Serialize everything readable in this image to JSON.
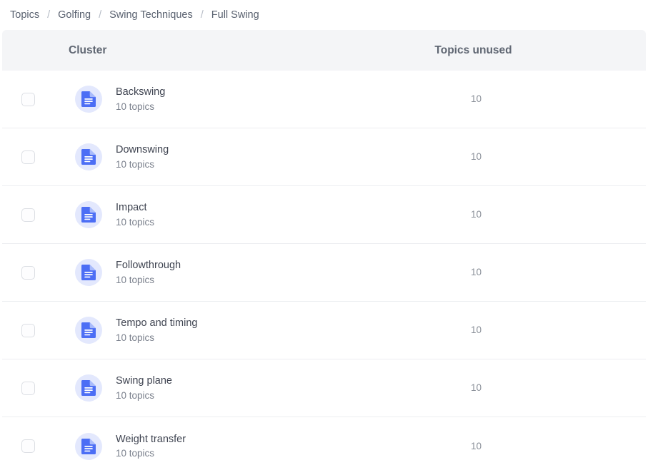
{
  "breadcrumb": {
    "separator": "/",
    "items": [
      {
        "label": "Topics"
      },
      {
        "label": "Golfing"
      },
      {
        "label": "Swing Techniques"
      },
      {
        "label": "Full Swing"
      }
    ]
  },
  "table": {
    "columns": {
      "cluster": "Cluster",
      "topics_unused": "Topics unused"
    },
    "rows": [
      {
        "name": "Backswing",
        "subtitle": "10 topics",
        "topics_unused": "10",
        "icon": "document-icon",
        "checked": false
      },
      {
        "name": "Downswing",
        "subtitle": "10 topics",
        "topics_unused": "10",
        "icon": "document-icon",
        "checked": false
      },
      {
        "name": "Impact",
        "subtitle": "10 topics",
        "topics_unused": "10",
        "icon": "document-icon",
        "checked": false
      },
      {
        "name": "Followthrough",
        "subtitle": "10 topics",
        "topics_unused": "10",
        "icon": "document-icon",
        "checked": false
      },
      {
        "name": "Tempo and timing",
        "subtitle": "10 topics",
        "topics_unused": "10",
        "icon": "document-icon",
        "checked": false
      },
      {
        "name": "Swing plane",
        "subtitle": "10 topics",
        "topics_unused": "10",
        "icon": "document-icon",
        "checked": false
      },
      {
        "name": "Weight transfer",
        "subtitle": "10 topics",
        "topics_unused": "10",
        "icon": "document-icon",
        "checked": false
      }
    ]
  },
  "colors": {
    "header_background": "#f4f5f7",
    "header_text": "#5f6672",
    "row_text": "#3f4451",
    "muted_text": "#7b818d",
    "breadcrumb_text": "#5a6270",
    "separator": "#b6bcc6",
    "icon_blue": "#4c6ef5",
    "icon_badge_background": "#e3e8fd",
    "row_divider": "#eceef1"
  }
}
